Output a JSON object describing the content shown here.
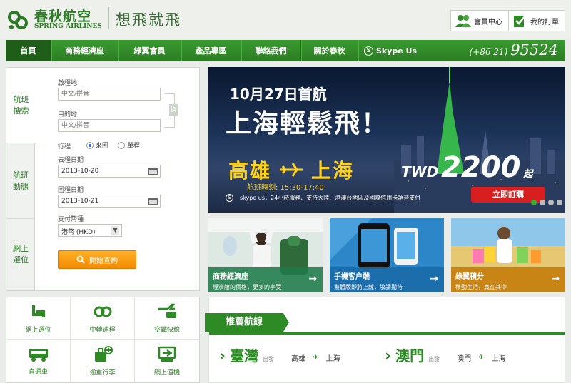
{
  "brand": {
    "name_cn": "春秋航空",
    "name_en": "SPRING AIRLINES",
    "slogan": "想飛就飛",
    "green": "#2d7a27"
  },
  "header_buttons": {
    "member": "會員中心",
    "orders": "我的訂單"
  },
  "nav": {
    "items": [
      "首頁",
      "商務經濟座",
      "綠翼會員",
      "產品專區",
      "聯絡我們",
      "關於春秋",
      "Skype Us"
    ],
    "phone_prefix": "(+86 21)",
    "phone_number": "95524"
  },
  "search": {
    "tabs": [
      "航班搜索",
      "航班動態",
      "網上選位"
    ],
    "origin_label": "啟程地",
    "origin_placeholder": "中文/拼音",
    "dest_label": "目的地",
    "dest_placeholder": "中文/拼音",
    "swap_label": "换",
    "trip_label": "行程",
    "trip_options": [
      "來回",
      "單程"
    ],
    "trip_selected": "來回",
    "depart_label": "去程日期",
    "depart_value": "2013-10-20",
    "return_label": "回程日期",
    "return_value": "2013-10-21",
    "currency_label": "支付幣種",
    "currency_value": "港幣 (HKD)",
    "submit": "開始查詢"
  },
  "banner": {
    "date": "10月27日首航",
    "title": "上海輕鬆飛！",
    "from": "高雄",
    "to": "上海",
    "schedule": "航班時刻: 15:30-17:40",
    "currency": "TWD",
    "price": "2200",
    "price_suffix": "起",
    "footer": "skype us，24小時服務、支持大陸、港澳台地區及國際信用卡語音支付",
    "book": "立即訂購",
    "slide_count": 4,
    "active_slide": 1
  },
  "cards": [
    {
      "title": "商務經濟座",
      "sub": "經濟艙的價格，更多的享受",
      "color": "#1f7a4a"
    },
    {
      "title": "手機客户端",
      "sub": "繁體版即將上線，敬請期待",
      "color": "#1b6aa8"
    },
    {
      "title": "綠翼積分",
      "sub": "移動生活，真在其中",
      "color": "#c47c0a"
    }
  ],
  "quick_links": [
    {
      "label": "網上選位",
      "icon": "seat-icon"
    },
    {
      "label": "中轉速程",
      "icon": "transfer-icon"
    },
    {
      "label": "空鐵快線",
      "icon": "plane-train-icon"
    },
    {
      "label": "直通車",
      "icon": "bus-icon"
    },
    {
      "label": "逾重行李",
      "icon": "luggage-icon"
    },
    {
      "label": "網上值機",
      "icon": "checkin-icon"
    }
  ],
  "recommended": {
    "title": "推薦航線",
    "routes": [
      {
        "city": "臺灣",
        "dep": "出發",
        "from": "高雄",
        "to": "上海"
      },
      {
        "city": "澳門",
        "dep": "出發",
        "from": "澳門",
        "to": "上海"
      }
    ]
  }
}
